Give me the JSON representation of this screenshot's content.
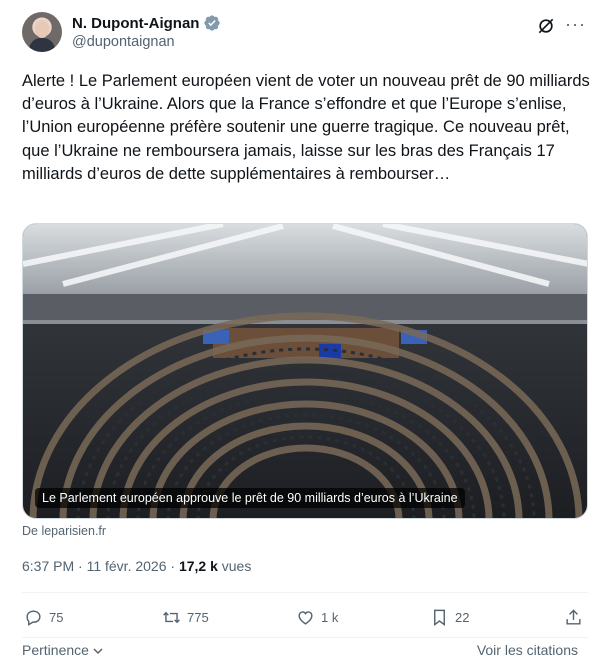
{
  "author": {
    "name": "N. Dupont-Aignan",
    "handle": "@dupontaignan"
  },
  "tweet": {
    "text": "Alerte ! Le Parlement européen vient de voter un nouveau prêt de 90 milliards d’euros à l’Ukraine. Alors que la France s’effondre et que l’Europe s’enlise, l’Union européenne préfère soutenir une guerre tragique. Ce nouveau prêt, que l’Ukraine ne remboursera jamais, laisse sur les bras des Français 17 milliards d’euros de dette supplémentaires à rembourser…"
  },
  "card": {
    "caption": "Le Parlement européen approuve le prêt de 90 milliards d’euros à l’Ukraine",
    "source": "De leparisien.fr"
  },
  "meta": {
    "time": "6:37 PM · 11 févr. 2026 · ",
    "views_count": "17,2 k",
    "views_label": " vues"
  },
  "actions": {
    "replies": "75",
    "reposts": "775",
    "likes": "1 k",
    "bookmarks": "22"
  },
  "footer": {
    "sort_label": "Pertinence",
    "quotes_label": "Voir les citations"
  },
  "colors": {
    "text": "#0f1419",
    "secondary": "#536471",
    "verified": "#829aab"
  },
  "icons": [
    "verified-badge-icon",
    "grok-icon",
    "more-icon",
    "reply-icon",
    "repost-icon",
    "like-icon",
    "bookmark-icon",
    "share-icon",
    "chevron-down-icon"
  ]
}
